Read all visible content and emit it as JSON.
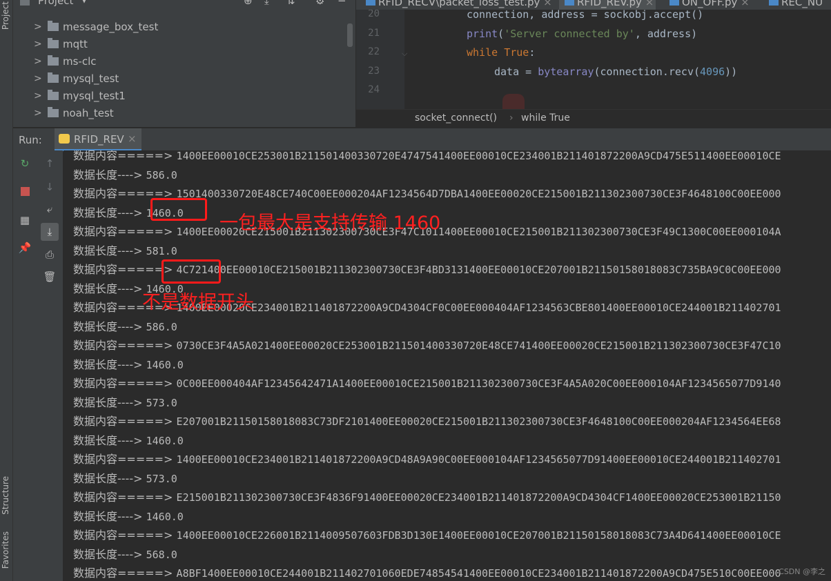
{
  "left_strip": {
    "top_label": "Project",
    "structure_label": "Structure",
    "favorites_label": "Favorites"
  },
  "project_panel": {
    "title": "Project",
    "items": [
      {
        "label": "message_box_test"
      },
      {
        "label": "mqtt"
      },
      {
        "label": "ms-clc"
      },
      {
        "label": "mysql_test"
      },
      {
        "label": "mysql_test1"
      },
      {
        "label": "noah_test"
      }
    ]
  },
  "editor": {
    "tabs": [
      {
        "label": "RFID_RECV\\packet_loss_test.py",
        "active": false
      },
      {
        "label": "RFID_REV.py",
        "active": true
      },
      {
        "label": "ON_OFF.py",
        "active": false
      },
      {
        "label": "REC_NU",
        "active": false
      }
    ],
    "line_numbers": [
      "20",
      "21",
      "22",
      "23",
      "24"
    ],
    "code": {
      "l20": "connection, address = sockobj.accept()",
      "l21_fn": "print",
      "l21_str": "'Server connected by'",
      "l21_rest": ", address)",
      "l22_kw1": "while",
      "l22_kw2": "True",
      "l22_rest": ":",
      "l23_a": "data = ",
      "l23_fn": "bytearray",
      "l23_b": "(connection.recv(",
      "l23_num": "4096",
      "l23_c": "))"
    },
    "breadcrumb": [
      "socket_connect()",
      "while True"
    ]
  },
  "run": {
    "label": "Run:",
    "tab_label": "RFID_REV"
  },
  "console": {
    "lines": [
      {
        "prefix": "数据内容=====>",
        "value": "1400EE00010CE253001B211501400330720E4747541400EE00010CE234001B211401872200A9CD475E511400EE00010CE"
      },
      {
        "prefix": "数据长度---->",
        "value": "586.0"
      },
      {
        "prefix": "数据内容=====>",
        "value": "1501400330720E48CE740C00EE000204AF1234564D7DBA1400EE00020CE215001B211302300730CE3F4648100C00EE000"
      },
      {
        "prefix": "数据长度---->",
        "value": "1460.0"
      },
      {
        "prefix": "数据内容=====>",
        "value": "1400EE00020CE215001B211302300730CE3F47C1011400EE00010CE215001B211302300730CE3F49C1300C00EE000104A"
      },
      {
        "prefix": "数据长度---->",
        "value": "581.0"
      },
      {
        "prefix": "数据内容=====>",
        "value": "4C721400EE00010CE215001B211302300730CE3F4BD3131400EE00010CE207001B21150158018083C735BA9C0C00EE000"
      },
      {
        "prefix": "数据长度---->",
        "value": "1460.0"
      },
      {
        "prefix": "数据内容=====>",
        "value": "1400EE00020CE234001B211401872200A9CD4304CF0C00EE000404AF1234563CBE801400EE00010CE244001B211402701"
      },
      {
        "prefix": "数据长度---->",
        "value": "586.0"
      },
      {
        "prefix": "数据内容=====>",
        "value": "0730CE3F4A5A021400EE00020CE253001B211501400330720E48CE741400EE00020CE215001B211302300730CE3F47C10"
      },
      {
        "prefix": "数据长度---->",
        "value": "1460.0"
      },
      {
        "prefix": "数据内容=====>",
        "value": "0C00EE000404AF12345642471A1400EE00010CE215001B211302300730CE3F4A5A020C00EE000104AF1234565077D9140"
      },
      {
        "prefix": "数据长度---->",
        "value": "573.0"
      },
      {
        "prefix": "数据内容=====>",
        "value": "E207001B21150158018083C73DF2101400EE00020CE215001B211302300730CE3F4648100C00EE000204AF1234564EE68"
      },
      {
        "prefix": "数据长度---->",
        "value": "1460.0"
      },
      {
        "prefix": "数据内容=====>",
        "value": "1400EE00010CE234001B211401872200A9CD48A9A90C00EE000104AF1234565077D91400EE00010CE244001B211402701"
      },
      {
        "prefix": "数据长度---->",
        "value": "573.0"
      },
      {
        "prefix": "数据内容=====>",
        "value": "E215001B211302300730CE3F4836F91400EE00020CE234001B211401872200A9CD4304CF1400EE00020CE253001B21150"
      },
      {
        "prefix": "数据长度---->",
        "value": "1460.0"
      },
      {
        "prefix": "数据内容=====>",
        "value": "1400EE00010CE226001B2114009507603FDB3D130E1400EE00010CE207001B21150158018083C73A4D641400EE00010CE"
      },
      {
        "prefix": "数据长度---->",
        "value": "568.0"
      },
      {
        "prefix": "数据内容=====>",
        "value": "A8BF1400EE00010CE244001B211402701060EDE74854541400EE00010CE234001B211401872200A9CD475E510C00EE000"
      }
    ]
  },
  "annotations": {
    "max_packet": "一包最大是支持传输 1460",
    "not_data_start": "不是数据开头"
  },
  "watermark": "CSDN @李之",
  "colors": {
    "annotation_red": "#ff1a1a",
    "console_bg": "#2b2b2b",
    "panel_bg": "#3c3f41"
  }
}
